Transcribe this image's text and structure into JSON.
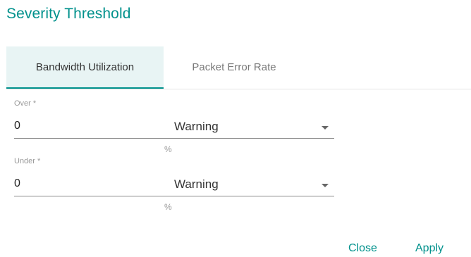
{
  "dialog": {
    "title": "Severity Threshold"
  },
  "tabs": [
    {
      "label": "Bandwidth Utilization",
      "active": true
    },
    {
      "label": "Packet Error Rate",
      "active": false
    }
  ],
  "form": {
    "over": {
      "label": "Over *",
      "value": "0",
      "severity": "Warning",
      "unit": "%"
    },
    "under": {
      "label": "Under *",
      "value": "0",
      "severity": "Warning",
      "unit": "%"
    }
  },
  "actions": {
    "close_label": "Close",
    "apply_label": "Apply"
  },
  "colors": {
    "accent": "#00918c",
    "active_tab_bg": "#e8f4f4"
  },
  "icons": {
    "dropdown": "caret-down-icon"
  }
}
